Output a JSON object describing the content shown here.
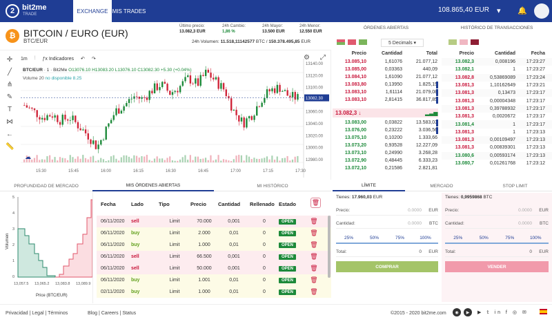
{
  "header": {
    "brand": "bit2me",
    "brand_sub": "TRADE",
    "logo_digit": "2",
    "tabs": [
      "EXCHANGE",
      "MIS TRADES"
    ],
    "balance": "108.865,40 EUR"
  },
  "market": {
    "title": "BITCOIN / EURO (EUR)",
    "pair": "BTC/EUR",
    "coin_symbol": "₿",
    "stats": [
      {
        "label": "Último precio:",
        "value": "13.082,3 EUR"
      },
      {
        "label": "24h Cambio:",
        "value": "1,86 %"
      },
      {
        "label": "24h Mayor:",
        "value": "13.500 EUR"
      },
      {
        "label": "24h Menor:",
        "value": "12.550 EUR"
      }
    ],
    "volume_label": "24h Volumen:",
    "volume_value": "11.518,11142577",
    "volume_unit1": "BTC /",
    "volume_value2": "150.378.495,85",
    "volume_unit2": "EUR"
  },
  "chart_toolbar": {
    "interval": "1m",
    "indicators": "Indicadores"
  },
  "chart_legend": {
    "pair": "BTC/EUR",
    "interval": "1",
    "exchange": "Bit2Me",
    "ohlc": "O13076.10 H13083.20 L13076.10 C13082.30 +5.30 (+0.04%)",
    "volume": "Volume 20",
    "volume_na": "no disponible",
    "volume_val": "8.25"
  },
  "chart_data": {
    "type": "candlestick",
    "price_ticks": [
      "13140.00",
      "13120.00",
      "13100.00",
      "13082.30",
      "13060.00",
      "13040.00",
      "13020.00",
      "13000.00",
      "12980.00"
    ],
    "time_ticks": [
      "15:30",
      "15:45",
      "16:00",
      "16:15",
      "16:30",
      "16:45",
      "17:00",
      "17:15",
      "17:30"
    ],
    "last_price": "13082.30",
    "ylim": [
      12975,
      13145
    ],
    "candle_count": 108
  },
  "orderbook": {
    "title": "ÓRDENES ABIERTAS",
    "decimals": "5 Decimals",
    "headers": [
      "Precio",
      "Cantidad",
      "Total"
    ],
    "asks": [
      [
        "13.085,10",
        "1,61076",
        "21.077,12"
      ],
      [
        "13.085,00",
        "0,03363",
        "440,09"
      ],
      [
        "13.084,10",
        "1,61090",
        "21.077,12"
      ],
      [
        "13.083,80",
        "0,13950",
        "1.825,15"
      ],
      [
        "13.083,10",
        "1,61114",
        "21.079,08"
      ],
      [
        "13.083,10",
        "2,81415",
        "36.817,85"
      ]
    ],
    "current": "13.082,3 ↓",
    "bids": [
      [
        "13.083,00",
        "0,03822",
        "13.583,03"
      ],
      [
        "13.076,00",
        "0,23222",
        "3.036,56"
      ],
      [
        "13.075,10",
        "0,10200",
        "1.333,66"
      ],
      [
        "13.073,20",
        "0,93528",
        "12.227,09"
      ],
      [
        "13.073,10",
        "0,24990",
        "3.268,28"
      ],
      [
        "13.072,90",
        "0,48445",
        "6.333,23"
      ],
      [
        "13.072,10",
        "0,21586",
        "2.821,81"
      ]
    ]
  },
  "history": {
    "title": "HISTÓRICO DE TRANSACCIONES",
    "headers": [
      "Precio",
      "Cantidad",
      "Fecha"
    ],
    "rows": [
      [
        "13.082,3",
        "0,008196",
        "17:23:27",
        "b"
      ],
      [
        "13.082,1",
        "1",
        "17:23:27",
        "b"
      ],
      [
        "13.082,8",
        "0,53869089",
        "17:23:24",
        "s"
      ],
      [
        "13.081,3",
        "1,10162649",
        "17:23:21",
        "s"
      ],
      [
        "13.081,3",
        "0,13473",
        "17:23:17",
        "s"
      ],
      [
        "13.081,3",
        "0,00004348",
        "17:23:17",
        "s"
      ],
      [
        "13.081,3",
        "0,39788932",
        "17:23:17",
        "s"
      ],
      [
        "13.081,3",
        "0,0020672",
        "17:23:17",
        "s"
      ],
      [
        "13.081,4",
        "1",
        "17:23:17",
        "b"
      ],
      [
        "13.081,3",
        "1",
        "17:23:13",
        "s"
      ],
      [
        "13.081,3",
        "0,00109497",
        "17:23:13",
        "s"
      ],
      [
        "13.081,3",
        "0,00839301",
        "17:23:13",
        "s"
      ],
      [
        "13.080,6",
        "0,00593174",
        "17:23:13",
        "b"
      ],
      [
        "13.080,7",
        "0,01261768",
        "17:23:12",
        "b"
      ]
    ]
  },
  "tabs_bottom": [
    "PROFUNDIDAD DE MERCADO",
    "MIS ÓRDENES ABIERTAS",
    "MI HISTÓRICO"
  ],
  "depth": {
    "ylabel": "Volumen",
    "xlabel": "Price (BTC/EUR)",
    "x_ticks": [
      "13,057.5",
      "13,065.2",
      "13,083.8",
      "13,089.9"
    ],
    "y_ticks": [
      "5",
      "4",
      "3",
      "2",
      "1",
      "0"
    ]
  },
  "orders": {
    "headers": [
      "Fecha",
      "Lado",
      "Tipo",
      "Precio",
      "Cantidad",
      "Rellenado",
      "Estado"
    ],
    "rows": [
      [
        "06/11/2020",
        "sell",
        "Limit",
        "70.000",
        "0,001",
        "0",
        "OPEN"
      ],
      [
        "06/11/2020",
        "buy",
        "Limit",
        "2.000",
        "0,01",
        "0",
        "OPEN"
      ],
      [
        "06/11/2020",
        "buy",
        "Limit",
        "1.000",
        "0,01",
        "0",
        "OPEN"
      ],
      [
        "06/11/2020",
        "sell",
        "Limit",
        "66.500",
        "0,001",
        "0",
        "OPEN"
      ],
      [
        "06/11/2020",
        "sell",
        "Limit",
        "50.000",
        "0,001",
        "0",
        "OPEN"
      ],
      [
        "06/11/2020",
        "buy",
        "Limit",
        "1.001",
        "0,01",
        "0",
        "OPEN"
      ],
      [
        "02/11/2020",
        "buy",
        "Limit",
        "1.000",
        "0,01",
        "0",
        "OPEN"
      ]
    ]
  },
  "trade": {
    "tabs": [
      "LÍMITE",
      "MERCADO",
      "STOP LIMIT"
    ],
    "buy": {
      "have_label": "Tienes:",
      "have_value": "17.960,03",
      "have_unit": "EUR",
      "price_label": "Precio:",
      "price_val": "0.0000",
      "price_unit": "EUR",
      "qty_label": "Cantidad:",
      "qty_val": "0.0000",
      "qty_unit": "BTC",
      "pcts": [
        "25%",
        "50%",
        "75%",
        "100%"
      ],
      "total_label": "Total:",
      "total_val": "0",
      "total_unit": "EUR",
      "button": "COMPRAR"
    },
    "sell": {
      "have_label": "Tienes:",
      "have_value": "0,9959868",
      "have_unit": "BTC",
      "price_label": "Precio:",
      "price_val": "0.0000",
      "price_unit": "EUR",
      "qty_label": "Cantidad:",
      "qty_val": "0.0000",
      "qty_unit": "BTC",
      "pcts": [
        "25%",
        "50%",
        "75%",
        "100%"
      ],
      "total_label": "Total:",
      "total_val": "0",
      "total_unit": "EUR",
      "button": "VENDER"
    }
  },
  "footer": {
    "links1": "Privacidad | Legal | Términos",
    "links2": "Blog | Careers | Status",
    "copyright": "©2015 - 2020  bit2me.com"
  }
}
